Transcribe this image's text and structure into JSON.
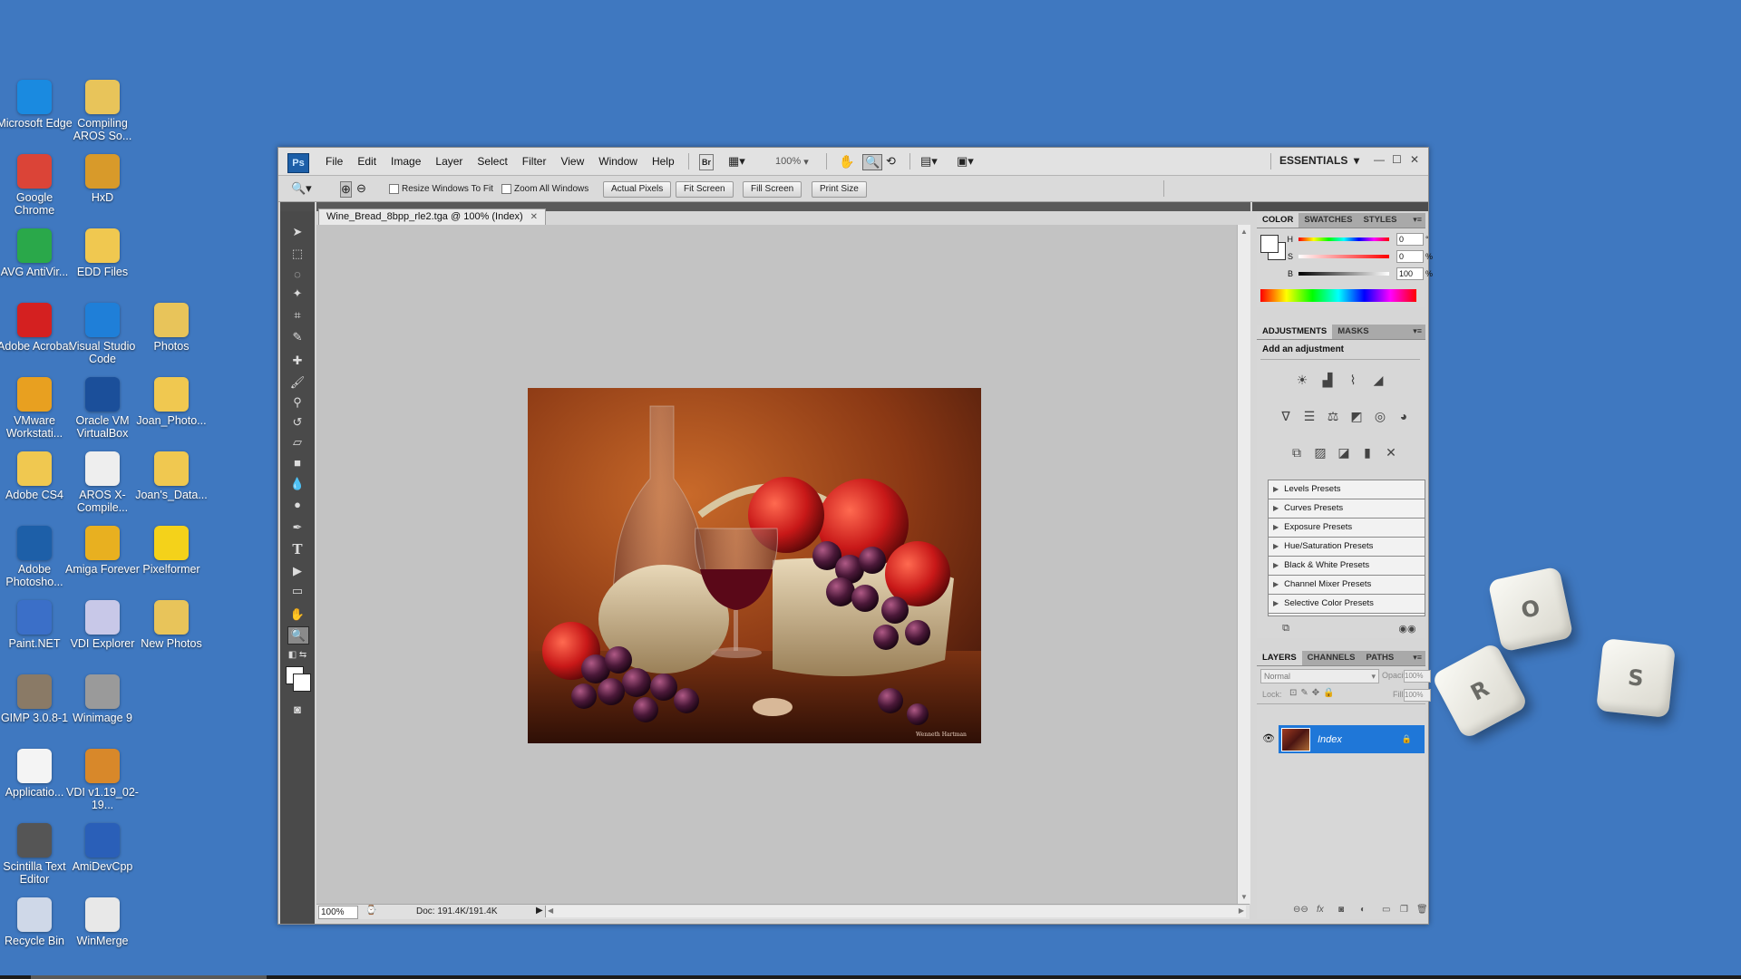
{
  "desktop": {
    "icons": [
      {
        "label": "Microsoft Edge",
        "icon": "edge-icon",
        "color": "#1a8ae0"
      },
      {
        "label": "Compiling AROS So...",
        "icon": "text-file-icon",
        "color": "#e8c45a"
      },
      {
        "label": "Google Chrome",
        "icon": "chrome-icon",
        "color": "#db4437"
      },
      {
        "label": "HxD",
        "icon": "hxd-icon",
        "color": "#d89a2a"
      },
      {
        "label": "AVG AntiVir...",
        "icon": "avg-icon",
        "color": "#2aa84a"
      },
      {
        "label": "EDD Files",
        "icon": "folder-icon",
        "color": "#f0c850"
      },
      {
        "label": "Adobe Acrobat",
        "icon": "acrobat-icon",
        "color": "#d42020"
      },
      {
        "label": "Visual Studio Code",
        "icon": "vscode-icon",
        "color": "#1f7fd8"
      },
      {
        "label": "Photos",
        "icon": "folder-icon",
        "color": "#e8c45a"
      },
      {
        "label": "VMware Workstati...",
        "icon": "vmware-icon",
        "color": "#e8a020"
      },
      {
        "label": "Oracle VM VirtualBox",
        "icon": "virtualbox-icon",
        "color": "#1b4f9a"
      },
      {
        "label": "Joan_Photo...",
        "icon": "folder-icon",
        "color": "#f0c850"
      },
      {
        "label": "Adobe CS4",
        "icon": "folder-icon",
        "color": "#f0c850"
      },
      {
        "label": "AROS X-Compile...",
        "icon": "text-file-icon",
        "color": "#eeeeee"
      },
      {
        "label": "Joan's_Data...",
        "icon": "folder-icon",
        "color": "#f0c850"
      },
      {
        "label": "Adobe Photosho...",
        "icon": "photoshop-icon",
        "color": "#1d5fa8"
      },
      {
        "label": "Amiga Forever",
        "icon": "amiga-icon",
        "color": "#e8b020"
      },
      {
        "label": "Pixelformer",
        "icon": "pixelformer-icon",
        "color": "#f4d21a"
      },
      {
        "label": "Paint.NET",
        "icon": "paintnet-icon",
        "color": "#3b6fc8"
      },
      {
        "label": "VDI Explorer",
        "icon": "disc-icon",
        "color": "#c8c8e8"
      },
      {
        "label": "New Photos",
        "icon": "folder-icon",
        "color": "#e8c45a"
      },
      {
        "label": "GIMP 3.0.8-1",
        "icon": "gimp-icon",
        "color": "#8a7a66"
      },
      {
        "label": "Winimage 9",
        "icon": "winimage-icon",
        "color": "#9a9a9a"
      },
      {
        "label": "Applicatio...",
        "icon": "text-file-icon",
        "color": "#f4f4f4"
      },
      {
        "label": "VDI v1.19_02-19...",
        "icon": "archive-icon",
        "color": "#d8882a"
      },
      {
        "label": "Scintilla Text Editor",
        "icon": "scintilla-icon",
        "color": "#555555"
      },
      {
        "label": "AmiDevCpp",
        "icon": "amidevcpp-icon",
        "color": "#2a5fb8"
      },
      {
        "label": "Recycle Bin",
        "icon": "recycle-bin-icon",
        "color": "#cfd8e8"
      },
      {
        "label": "WinMerge",
        "icon": "winmerge-icon",
        "color": "#e8e8e8"
      }
    ]
  },
  "keycaps": [
    "O",
    "R",
    "S"
  ],
  "photoshop": {
    "logo": "Ps",
    "menu": [
      "File",
      "Edit",
      "Image",
      "Layer",
      "Select",
      "Filter",
      "View",
      "Window",
      "Help"
    ],
    "menubar": {
      "bridge": "Br",
      "zoom": "100%",
      "workspace": "ESSENTIALS"
    },
    "options": {
      "resize_windows": "Resize Windows To Fit",
      "zoom_all": "Zoom All Windows",
      "actual_pixels": "Actual Pixels",
      "fit_screen": "Fit Screen",
      "fill_screen": "Fill Screen",
      "print_size": "Print Size"
    },
    "document": {
      "tab_title": "Wine_Bread_8bpp_rle2.tga @ 100% (Index)",
      "zoom": "100%",
      "doc_info": "Doc: 191.4K/191.4K",
      "signature": "Wenneth Hartman"
    },
    "color_panel": {
      "tabs": [
        "COLOR",
        "SWATCHES",
        "STYLES"
      ],
      "h": {
        "label": "H",
        "value": "0",
        "unit": "°"
      },
      "s": {
        "label": "S",
        "value": "0",
        "unit": "%"
      },
      "b": {
        "label": "B",
        "value": "100",
        "unit": "%"
      }
    },
    "adjustments_panel": {
      "tabs": [
        "ADJUSTMENTS",
        "MASKS"
      ],
      "heading": "Add an adjustment",
      "presets": [
        "Levels Presets",
        "Curves Presets",
        "Exposure Presets",
        "Hue/Saturation Presets",
        "Black & White Presets",
        "Channel Mixer Presets",
        "Selective Color Presets"
      ]
    },
    "layers_panel": {
      "tabs": [
        "LAYERS",
        "CHANNELS",
        "PATHS"
      ],
      "blend_mode": "Normal",
      "opacity_label": "Opacity:",
      "opacity": "100%",
      "lock_label": "Lock:",
      "fill_label": "Fill:",
      "fill": "100%",
      "layer_name": "Index"
    }
  }
}
